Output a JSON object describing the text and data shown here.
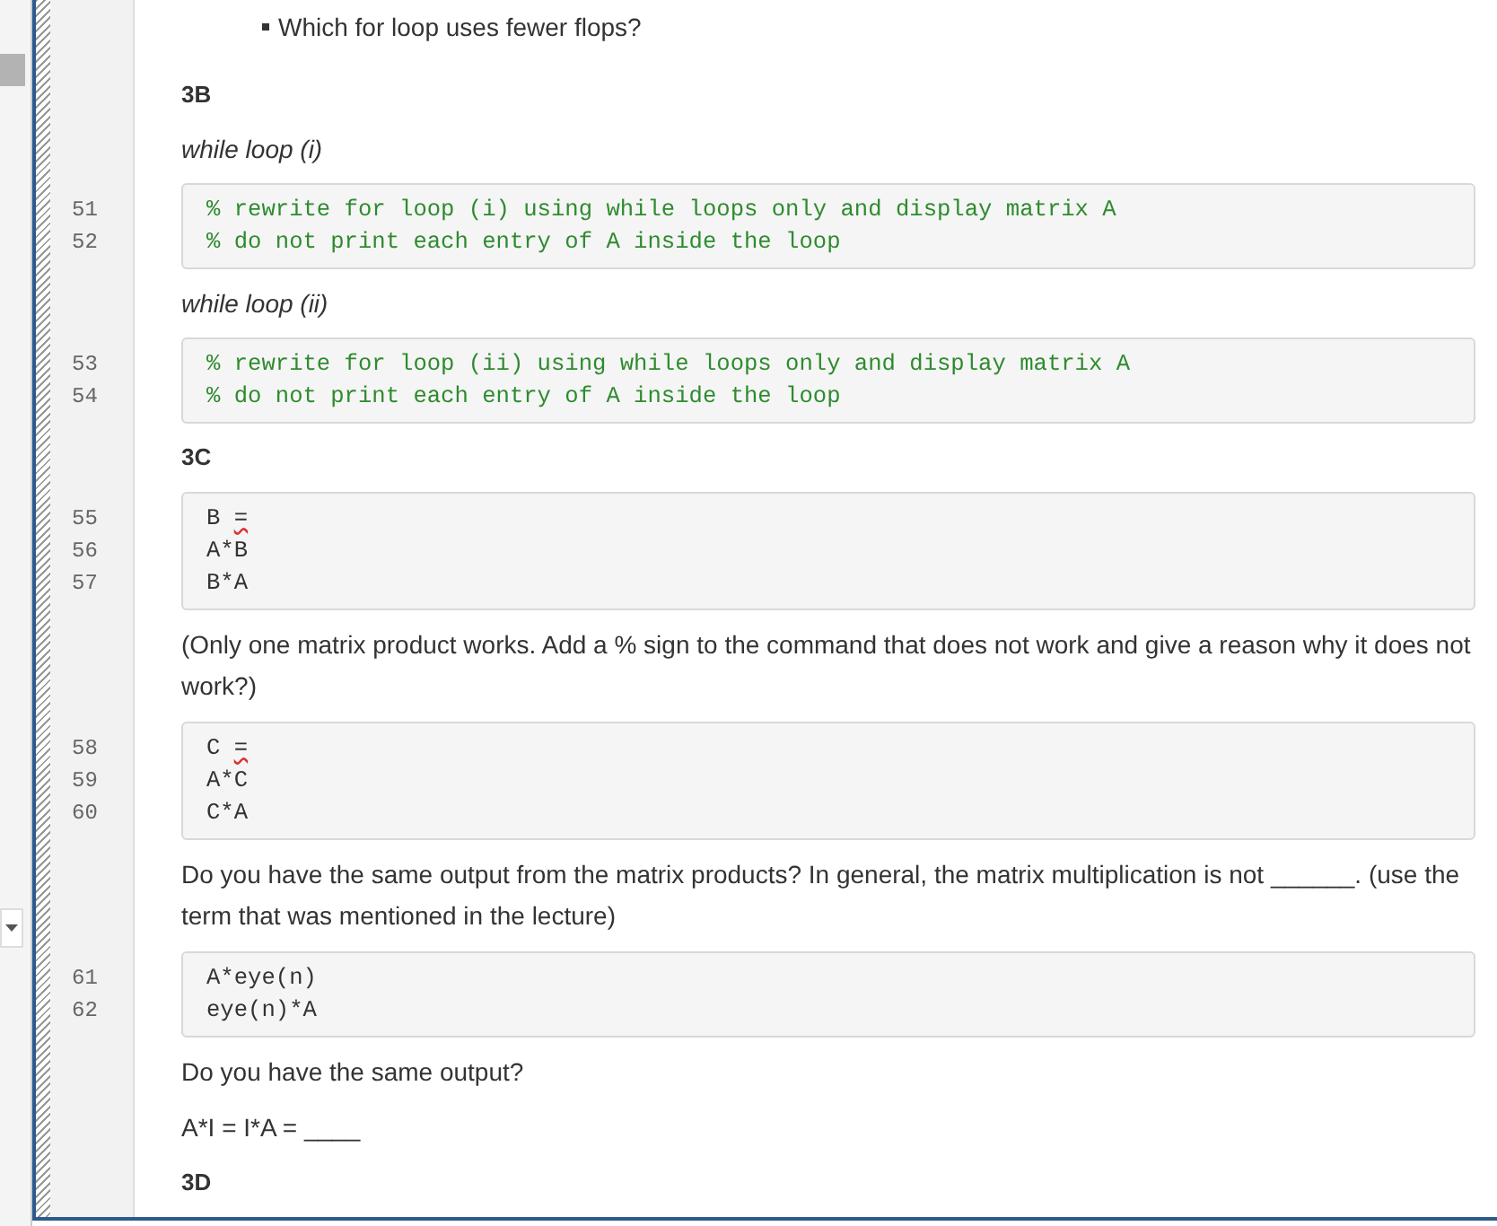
{
  "items": [
    {
      "kind": "bullet",
      "text": "Which for loop uses fewer flops?"
    },
    {
      "kind": "heading",
      "text": "3B"
    },
    {
      "kind": "caption",
      "text": "while loop (i)"
    },
    {
      "kind": "code",
      "lines": [
        {
          "number": "51",
          "text": "% rewrite for loop (i) using while loops only and display matrix A",
          "comment": true,
          "flagged": false
        },
        {
          "number": "52",
          "text": "% do not print each entry of A inside the loop",
          "comment": true,
          "flagged": false
        }
      ]
    },
    {
      "kind": "caption",
      "text": "while loop (ii)"
    },
    {
      "kind": "code",
      "lines": [
        {
          "number": "53",
          "text": "% rewrite for loop (ii) using while loops only and display matrix A",
          "comment": true,
          "flagged": false
        },
        {
          "number": "54",
          "text": "% do not print each entry of A inside the loop",
          "comment": true,
          "flagged": false
        }
      ]
    },
    {
      "kind": "heading",
      "text": "3C"
    },
    {
      "kind": "code",
      "lines": [
        {
          "number": "55",
          "text": "B =",
          "comment": false,
          "flagged": true
        },
        {
          "number": "56",
          "text": "A*B",
          "comment": false,
          "flagged": false
        },
        {
          "number": "57",
          "text": "B*A",
          "comment": false,
          "flagged": false
        }
      ]
    },
    {
      "kind": "paragraph",
      "text": "(Only one matrix product works.  Add a % sign to the command that does not work and give a reason why it does not work?)"
    },
    {
      "kind": "code",
      "lines": [
        {
          "number": "58",
          "text": "C =",
          "comment": false,
          "flagged": true
        },
        {
          "number": "59",
          "text": "A*C",
          "comment": false,
          "flagged": false
        },
        {
          "number": "60",
          "text": "C*A",
          "comment": false,
          "flagged": false
        }
      ]
    },
    {
      "kind": "paragraph",
      "text": "Do you have the same output from the matrix products?  In general, the matrix multiplication is not ______. (use the term that was mentioned in the lecture)"
    },
    {
      "kind": "code",
      "lines": [
        {
          "number": "61",
          "text": "A*eye(n)",
          "comment": false,
          "flagged": false
        },
        {
          "number": "62",
          "text": "eye(n)*A",
          "comment": false,
          "flagged": false
        }
      ]
    },
    {
      "kind": "paragraph",
      "text": "Do you have the same output?"
    },
    {
      "kind": "paragraph",
      "text": "A*I = I*A = ____"
    },
    {
      "kind": "heading",
      "text": "3D"
    }
  ]
}
